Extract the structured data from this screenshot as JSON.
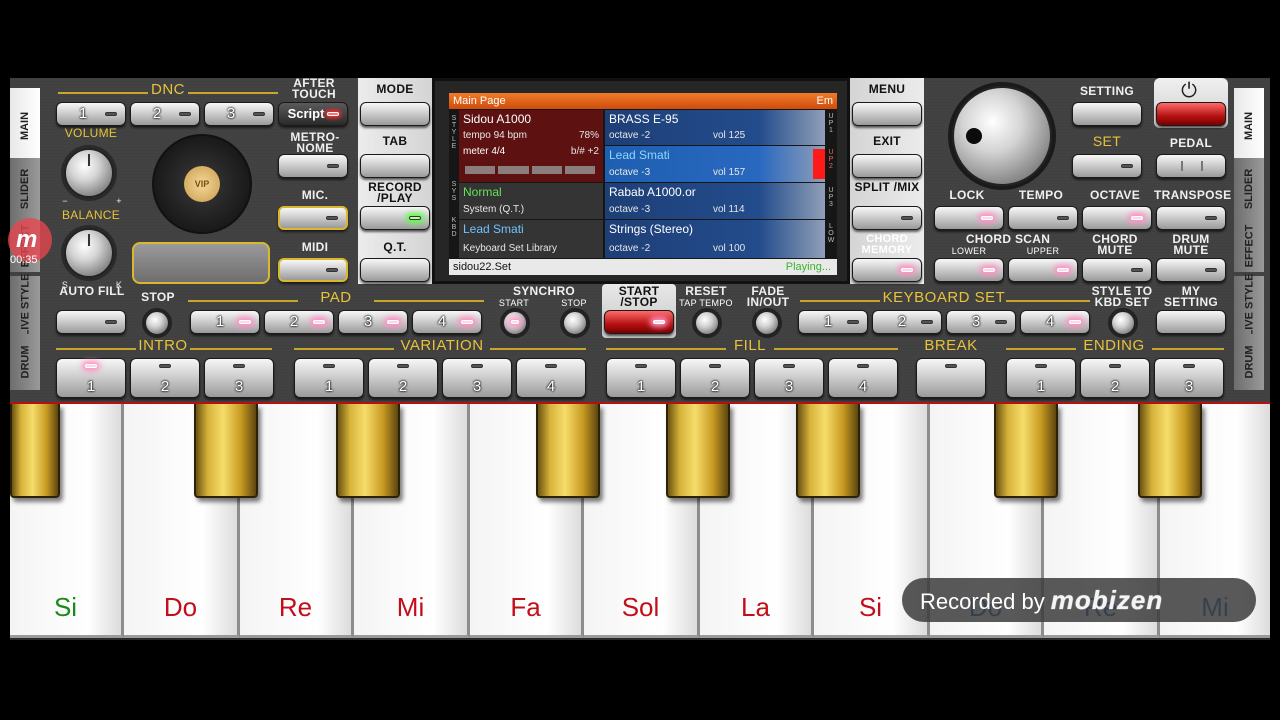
{
  "side_left": [
    "MAIN",
    "SLIDER",
    "EFFECT",
    "LIVE STYLE",
    "DRUM"
  ],
  "side_right": [
    "MAIN",
    "SLIDER",
    "EFFECT",
    "LIVE STYLE",
    "DRUM"
  ],
  "dnc": {
    "title": "DNC",
    "buttons": [
      "1",
      "2",
      "3"
    ],
    "script": "Script"
  },
  "after_touch": "AFTER TOUCH",
  "volume": "VOLUME",
  "volume_minus": "−",
  "volume_plus": "+",
  "balance": "BALANCE",
  "balance_s": "S",
  "balance_k": "K",
  "metronome": "METRO- NOME",
  "mic": "MIC.",
  "midi": "MIDI",
  "vip": "VIP",
  "mode": "MODE",
  "tab": "TAB",
  "record_play": "RECORD /PLAY",
  "qt": "Q.T.",
  "menu": "MENU",
  "exit": "EXIT",
  "split_mix": "SPLIT /MIX",
  "chord_memory": "CHORD MEMORY",
  "setting": "SETTING",
  "set": "SET",
  "pedal": "PEDAL",
  "lock": "LOCK",
  "tempo": "TEMPO",
  "octave": "OCTAVE",
  "transpose": "TRANSPOSE",
  "chord_scan": "CHORD SCAN",
  "chord_scan_lower": "LOWER",
  "chord_scan_upper": "UPPER",
  "chord_mute": "CHORD MUTE",
  "drum_mute": "DRUM MUTE",
  "lcd": {
    "title": "Main Page",
    "key": "Em",
    "style_label": "S T Y L E",
    "sys_label": "S Y S",
    "kbd_label": "K B D",
    "style_name": "Sidou A1000",
    "tempo": "tempo 94 bpm",
    "percent": "78%",
    "meter": "meter 4/4",
    "transpose": "b/# +2",
    "sys_name": "Normal",
    "sys_sub": "System (Q.T.)",
    "kbd_name": "Lead Smati",
    "kbd_sub": "Keyboard Set Library",
    "up1": {
      "label": "U P 1",
      "name": "BRASS E-95",
      "octave": "octave -2",
      "vol": "vol 125"
    },
    "up2": {
      "label": "U P 2",
      "name": "Lead Smati",
      "octave": "octave -3",
      "vol": "vol 157"
    },
    "up3": {
      "label": "U P 3",
      "name": "Rabab A1000.or",
      "octave": "octave -3",
      "vol": "vol 114"
    },
    "low": {
      "label": "L O W",
      "name": "Strings (Stereo)",
      "octave": "octave -2",
      "vol": "vol 100"
    },
    "file": "sidou22.Set",
    "status": "Playing..."
  },
  "auto_fill": "AUTO FILL",
  "stop": "STOP",
  "pad": {
    "title": "PAD",
    "buttons": [
      "1",
      "2",
      "3",
      "4"
    ]
  },
  "synchro": "SYNCHRO",
  "synchro_start": "START",
  "synchro_stop": "STOP",
  "start_stop": "START /STOP",
  "reset": "RESET",
  "tap_tempo": "TAP TEMPO",
  "fade": "FADE IN/OUT",
  "keyboard_set": {
    "title": "KEYBOARD SET",
    "buttons": [
      "1",
      "2",
      "3",
      "4"
    ]
  },
  "style_to_kbd": "STYLE TO KBD SET",
  "my_setting": "MY SETTING",
  "intro": {
    "title": "INTRO",
    "buttons": [
      "1",
      "2",
      "3"
    ]
  },
  "variation": {
    "title": "VARIATION",
    "buttons": [
      "1",
      "2",
      "3",
      "4"
    ]
  },
  "fill": {
    "title": "FILL",
    "buttons": [
      "1",
      "2",
      "3",
      "4"
    ]
  },
  "break": "BREAK",
  "ending": {
    "title": "ENDING",
    "buttons": [
      "1",
      "2",
      "3"
    ]
  },
  "notes": [
    "Si",
    "Do",
    "Re",
    "Mi",
    "Fa",
    "Sol",
    "La",
    "Si",
    "Do",
    "Re",
    "Mi"
  ],
  "overlay": {
    "recorded_by": "Recorded by",
    "brand": "mobizen",
    "timer": "00:35"
  },
  "colors": {
    "lcd_header": "#e4611a",
    "note_red": "#c40d1a",
    "note_green": "#1a8a1a",
    "highlight_blue": "#1e5fb0"
  }
}
